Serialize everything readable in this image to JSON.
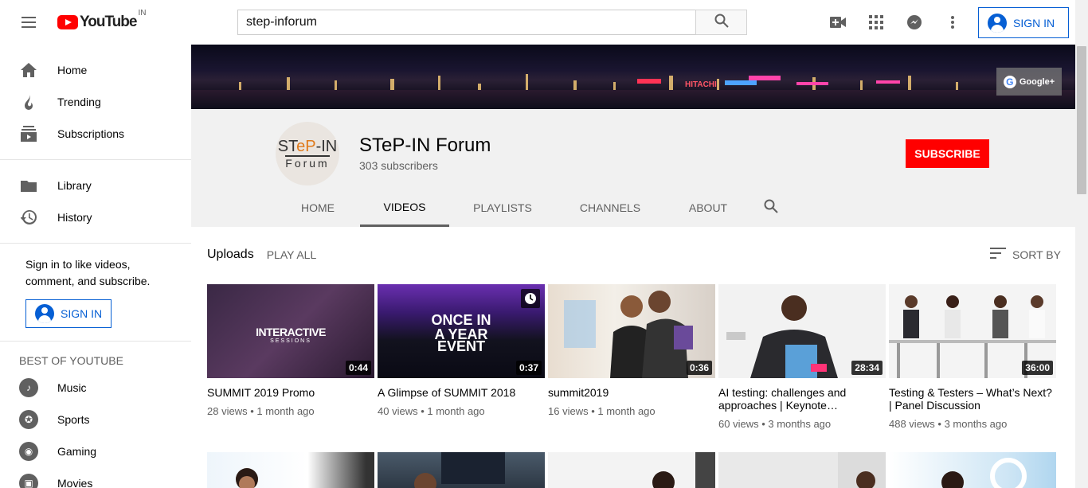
{
  "logo": {
    "text": "YouTube",
    "country": "IN"
  },
  "search": {
    "value": "step-inforum"
  },
  "header": {
    "signin_label": "SIGN IN"
  },
  "sidebar": {
    "primary": [
      {
        "label": "Home",
        "icon": "home-icon"
      },
      {
        "label": "Trending",
        "icon": "trending-icon"
      },
      {
        "label": "Subscriptions",
        "icon": "subscriptions-icon"
      }
    ],
    "library": [
      {
        "label": "Library",
        "icon": "library-icon"
      },
      {
        "label": "History",
        "icon": "history-icon"
      }
    ],
    "signin_prompt": "Sign in to like videos, comment, and subscribe.",
    "signin_label": "SIGN IN",
    "best_heading": "BEST OF YOUTUBE",
    "best": [
      {
        "label": "Music",
        "icon": "music-icon"
      },
      {
        "label": "Sports",
        "icon": "sports-icon"
      },
      {
        "label": "Gaming",
        "icon": "gaming-icon"
      },
      {
        "label": "Movies",
        "icon": "movies-icon"
      }
    ]
  },
  "banner": {
    "gplus_label": "Google+",
    "sign_text": "HITACHI"
  },
  "channel": {
    "name": "STeP-IN Forum",
    "subscribers": "303 subscribers",
    "avatar_line1_a": "ST",
    "avatar_line1_b": "eP",
    "avatar_line1_c": "-IN",
    "avatar_line2": "Forum",
    "subscribe_label": "SUBSCRIBE",
    "tabs": [
      {
        "label": "HOME",
        "active": false
      },
      {
        "label": "VIDEOS",
        "active": true
      },
      {
        "label": "PLAYLISTS",
        "active": false
      },
      {
        "label": "CHANNELS",
        "active": false
      },
      {
        "label": "ABOUT",
        "active": false
      }
    ]
  },
  "uploads": {
    "title": "Uploads",
    "play_all": "PLAY ALL",
    "sort_by": "SORT BY",
    "videos": [
      {
        "title": "SUMMIT 2019 Promo",
        "views": "28 views",
        "age": "1 month ago",
        "duration": "0:44",
        "thumb_text": "INTERACTIVE",
        "thumb_sub": "SESSIONS"
      },
      {
        "title": "A Glimpse of SUMMIT 2018",
        "views": "40 views",
        "age": "1 month ago",
        "duration": "0:37",
        "thumb_text": "ONCE IN A YEAR",
        "thumb_sub": "EVENT"
      },
      {
        "title": "summit2019",
        "views": "16 views",
        "age": "1 month ago",
        "duration": "0:36"
      },
      {
        "title": "AI testing: challenges and approaches | Keynote…",
        "views": "60 views",
        "age": "3 months ago",
        "duration": "28:34"
      },
      {
        "title": "Testing & Testers – What’s Next? | Panel Discussion",
        "views": "488 views",
        "age": "3 months ago",
        "duration": "36:00"
      }
    ]
  },
  "colors": {
    "accent_blue": "#065fd4",
    "subscribe_red": "#ff0000"
  }
}
